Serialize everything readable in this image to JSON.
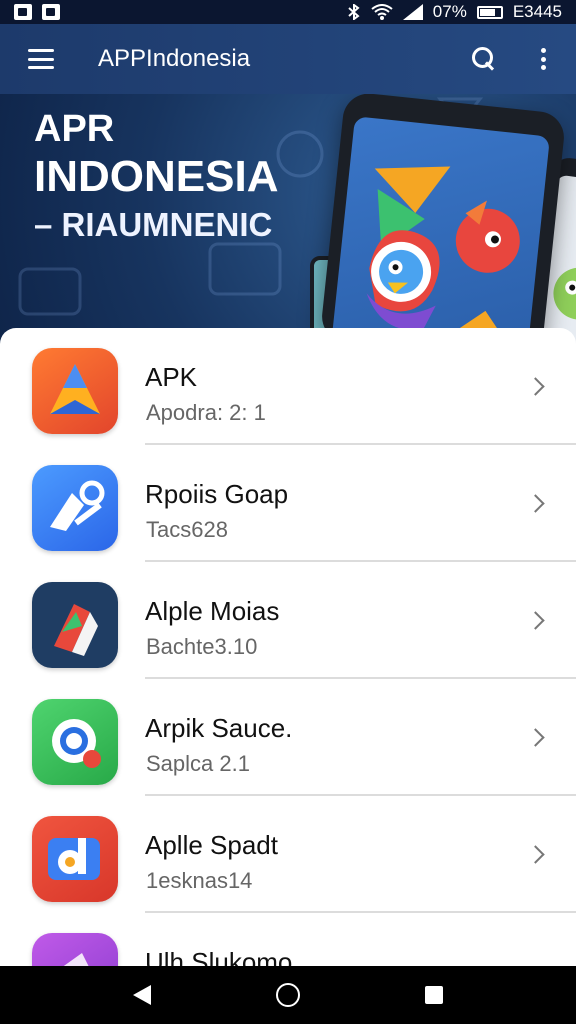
{
  "status_bar": {
    "battery_percent": "07%",
    "time": "E3445"
  },
  "app_bar": {
    "title": "APPIndonesia"
  },
  "hero": {
    "line1": "APR",
    "line2": "INDONESIA",
    "line3": "– RIAUMNENIC"
  },
  "apps": [
    {
      "name": "APK",
      "subtitle": "Apodra: 2: 1",
      "icon": "triangle-logo-icon",
      "color": "#f26d2d"
    },
    {
      "name": "Rpoiis Goap",
      "subtitle": "Tacs628",
      "icon": "arrow-logo-icon",
      "color": "#3b7ff2"
    },
    {
      "name": "Alple Moias",
      "subtitle": "Bachte3.10",
      "icon": "flag-logo-icon",
      "color": "#1f4c73"
    },
    {
      "name": "Arpik Sauce.",
      "subtitle": "Saplca 2.1",
      "icon": "ring-logo-icon",
      "color": "#2fbe5a"
    },
    {
      "name": "Aplle Spadt",
      "subtitle": "1esknas14",
      "icon": "letter-logo-icon",
      "color": "#e8483b"
    },
    {
      "name": "Ulh Slukomo",
      "subtitle": "",
      "icon": "purple-logo-icon",
      "color": "#a64cd9"
    }
  ]
}
